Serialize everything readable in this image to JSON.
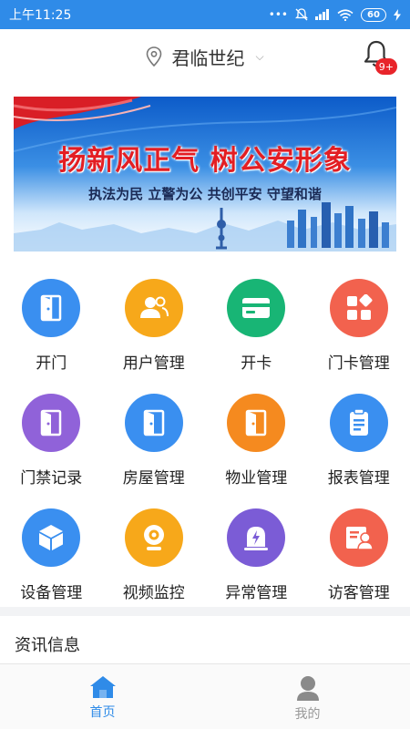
{
  "status_bar": {
    "time": "上午11:25",
    "battery": "60"
  },
  "header": {
    "location": "君临世纪",
    "notification_badge": "9+"
  },
  "banner": {
    "headline": "扬新风正气  树公安形象",
    "subline": "执法为民 立警为公 共创平安 守望和谐"
  },
  "grid": [
    {
      "label": "开门",
      "color": "#3a8ff0",
      "icon": "door-icon"
    },
    {
      "label": "用户管理",
      "color": "#f7a81a",
      "icon": "users-icon"
    },
    {
      "label": "开卡",
      "color": "#18b575",
      "icon": "card-icon"
    },
    {
      "label": "门卡管理",
      "color": "#f2624e",
      "icon": "apps-icon"
    },
    {
      "label": "门禁记录",
      "color": "#9062d9",
      "icon": "door-icon"
    },
    {
      "label": "房屋管理",
      "color": "#3a8ff0",
      "icon": "door-icon"
    },
    {
      "label": "物业管理",
      "color": "#f58a1f",
      "icon": "door-icon"
    },
    {
      "label": "报表管理",
      "color": "#3a8ff0",
      "icon": "report-icon"
    },
    {
      "label": "设备管理",
      "color": "#3a8ff0",
      "icon": "box-icon"
    },
    {
      "label": "视频监控",
      "color": "#f7a81a",
      "icon": "camera-icon"
    },
    {
      "label": "异常管理",
      "color": "#7b5cd6",
      "icon": "alert-icon"
    },
    {
      "label": "访客管理",
      "color": "#f2624e",
      "icon": "visitor-icon"
    }
  ],
  "news": {
    "title": "资讯信息"
  },
  "tabbar": {
    "home": "首页",
    "mine": "我的",
    "active_color": "#2f8be8"
  }
}
